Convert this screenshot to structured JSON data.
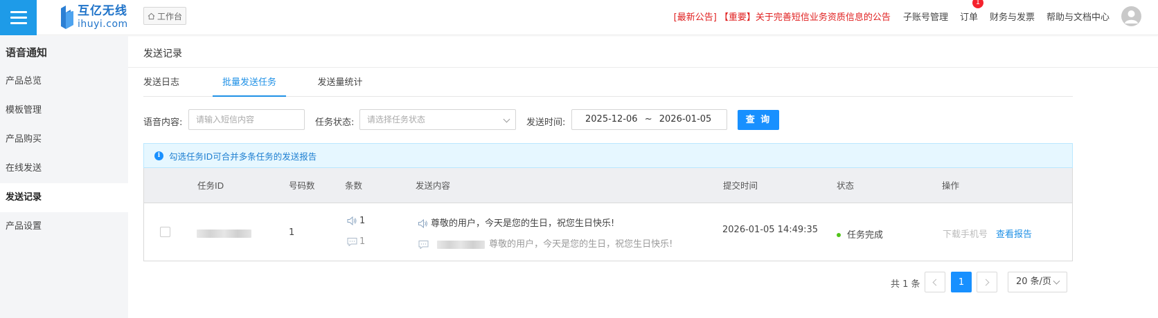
{
  "header": {
    "logo_cn": "互亿无线",
    "logo_en": "ihuyi.com",
    "workbench": "工作台",
    "notice": "[最新公告] 【重要】关于完善短信业务资质信息的公告",
    "links": [
      "子账号管理",
      "订单",
      "财务与发票",
      "帮助与文档中心"
    ],
    "order_badge": "1"
  },
  "sidebar": {
    "title": "语音通知",
    "items": [
      {
        "label": "产品总览"
      },
      {
        "label": "模板管理"
      },
      {
        "label": "产品购买"
      },
      {
        "label": "在线发送"
      },
      {
        "label": "发送记录",
        "active": true
      },
      {
        "label": "产品设置"
      }
    ]
  },
  "page": {
    "title": "发送记录",
    "tabs": [
      {
        "label": "发送日志"
      },
      {
        "label": "批量发送任务",
        "active": true
      },
      {
        "label": "发送量统计"
      }
    ]
  },
  "filters": {
    "content_label": "语音内容:",
    "content_placeholder": "请输入短信内容",
    "status_label": "任务状态:",
    "status_placeholder": "请选择任务状态",
    "time_label": "发送时间:",
    "date_start": "2025-12-06",
    "date_sep": "~",
    "date_end": "2026-01-05",
    "query_button": "查 询"
  },
  "alert": {
    "icon": "i",
    "text": "勾选任务ID可合并多条任务的发送报告"
  },
  "table": {
    "headers": [
      "任务ID",
      "号码数",
      "条数",
      "发送内容",
      "提交时间",
      "状态",
      "操作"
    ],
    "rows": [
      {
        "task_id": "",
        "numbers": "1",
        "voice_count": "1",
        "sms_count": "1",
        "voice_content": "尊敬的用户，今天是您的生日，祝您生日快乐!",
        "sms_content": "尊敬的用户，今天是您的生日，祝您生日快乐!",
        "submit_time": "2026-01-05 14:49:35",
        "status": "任务完成",
        "action_download": "下载手机号",
        "action_report": "查看报告"
      }
    ]
  },
  "pagination": {
    "total_text": "共 1 条",
    "current_page": "1",
    "page_size": "20 条/页"
  },
  "colors": {
    "brand": "#1e9be8",
    "primary": "#1890ff",
    "notice": "#e02020",
    "status_success": "#52c41a"
  }
}
